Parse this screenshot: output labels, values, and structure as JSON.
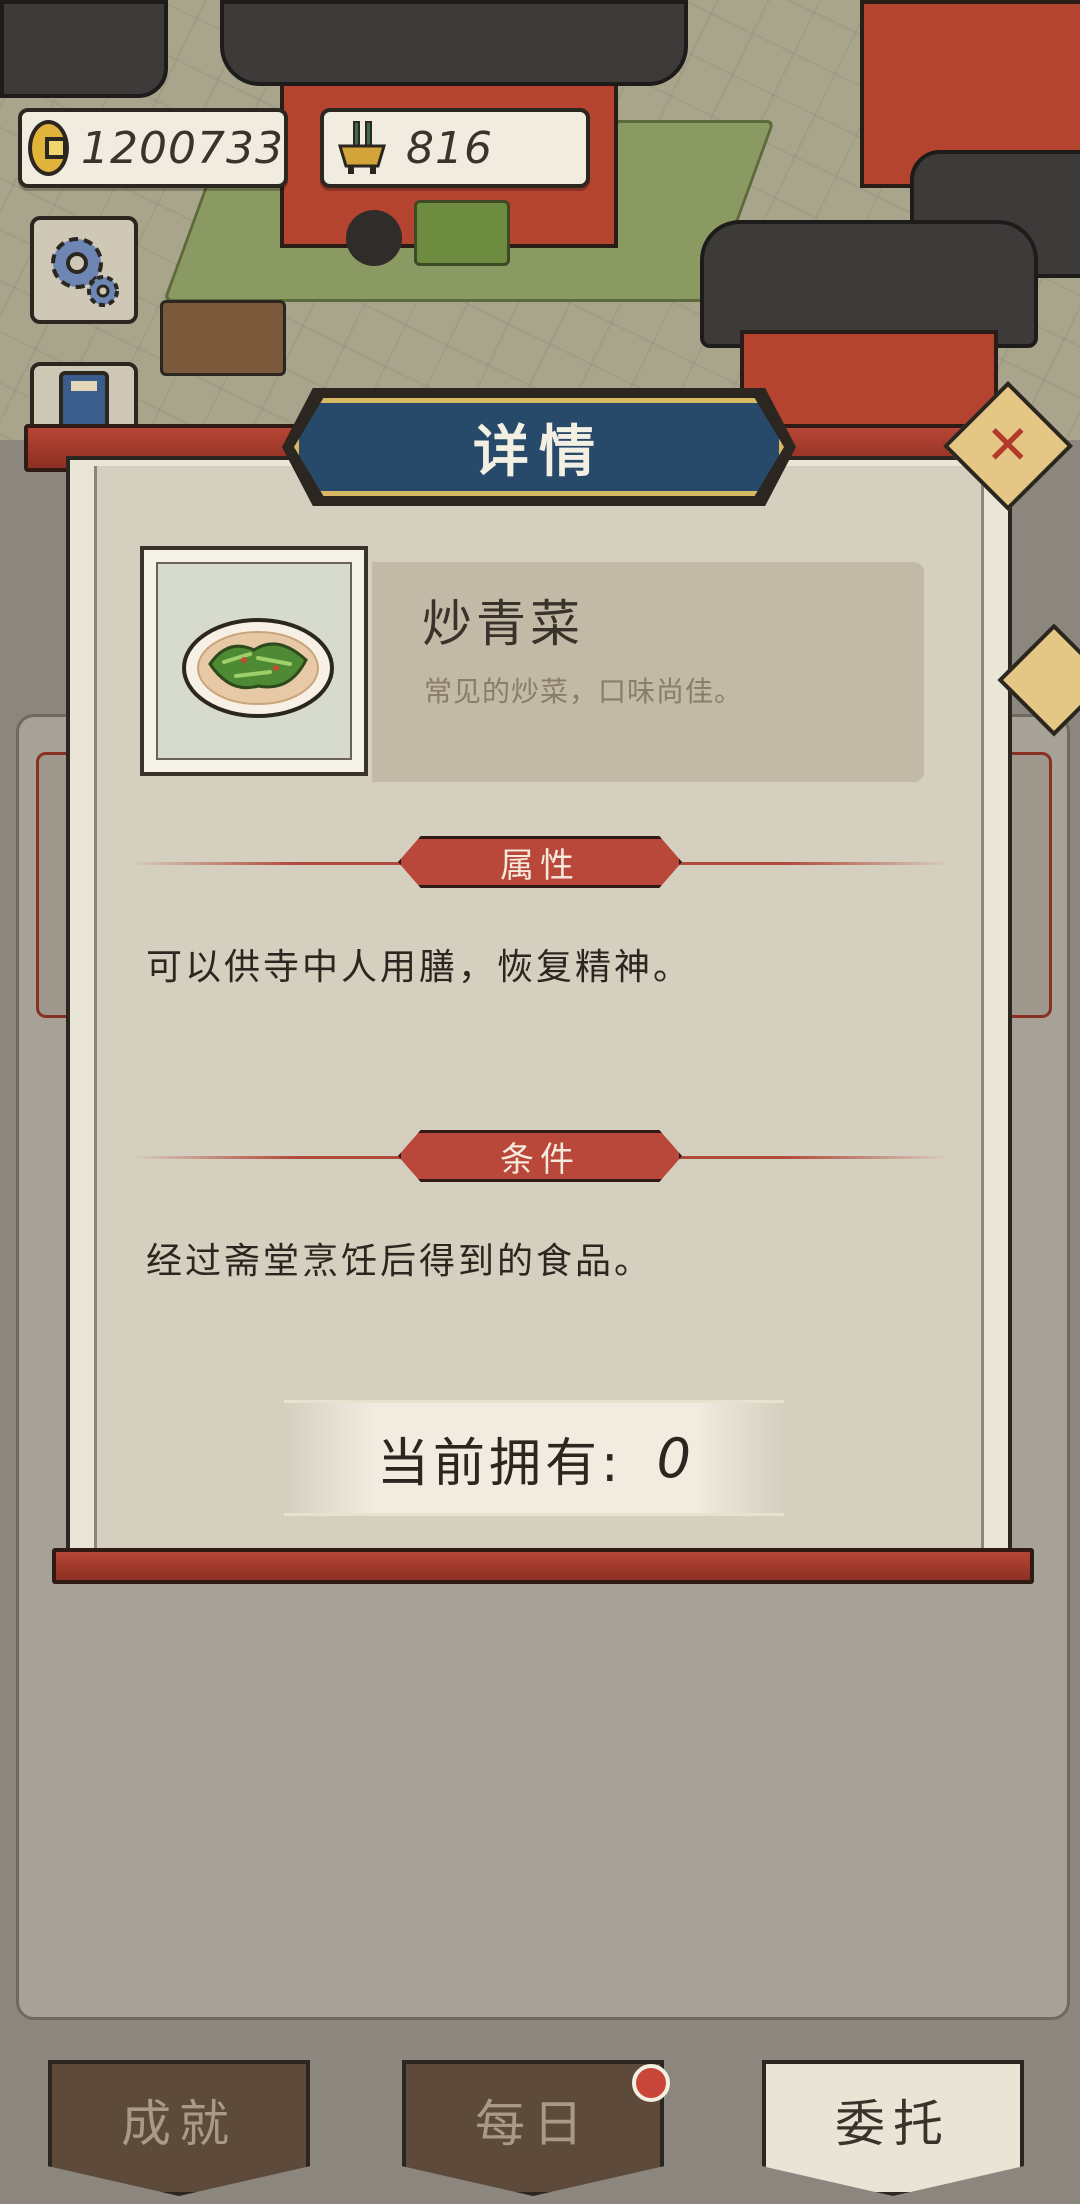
{
  "hud": {
    "coins": "1200733",
    "incense": "816"
  },
  "panel": {
    "title": "详情",
    "close_symbol": "✕"
  },
  "item": {
    "name": "炒青菜",
    "description": "常见的炒菜，口味尚佳。",
    "image_icon": "stir-fried-greens-dish-icon"
  },
  "sections": {
    "attribute_title": "属性",
    "attribute_text": "可以供寺中人用膳，恢复精神。",
    "condition_title": "条件",
    "condition_text": "经过斋堂烹饪后得到的食品。"
  },
  "ownership": {
    "label": "当前拥有:",
    "value": "0"
  },
  "tabs": [
    {
      "label": "成就",
      "active": false
    },
    {
      "label": "每日",
      "active": false,
      "badge": true
    },
    {
      "label": "委托",
      "active": true
    }
  ],
  "colors": {
    "banner_blue": "#284a6a",
    "accent_red": "#b9473a",
    "parchment": "#d5cfbf",
    "coin_gold": "#e0b43a"
  }
}
